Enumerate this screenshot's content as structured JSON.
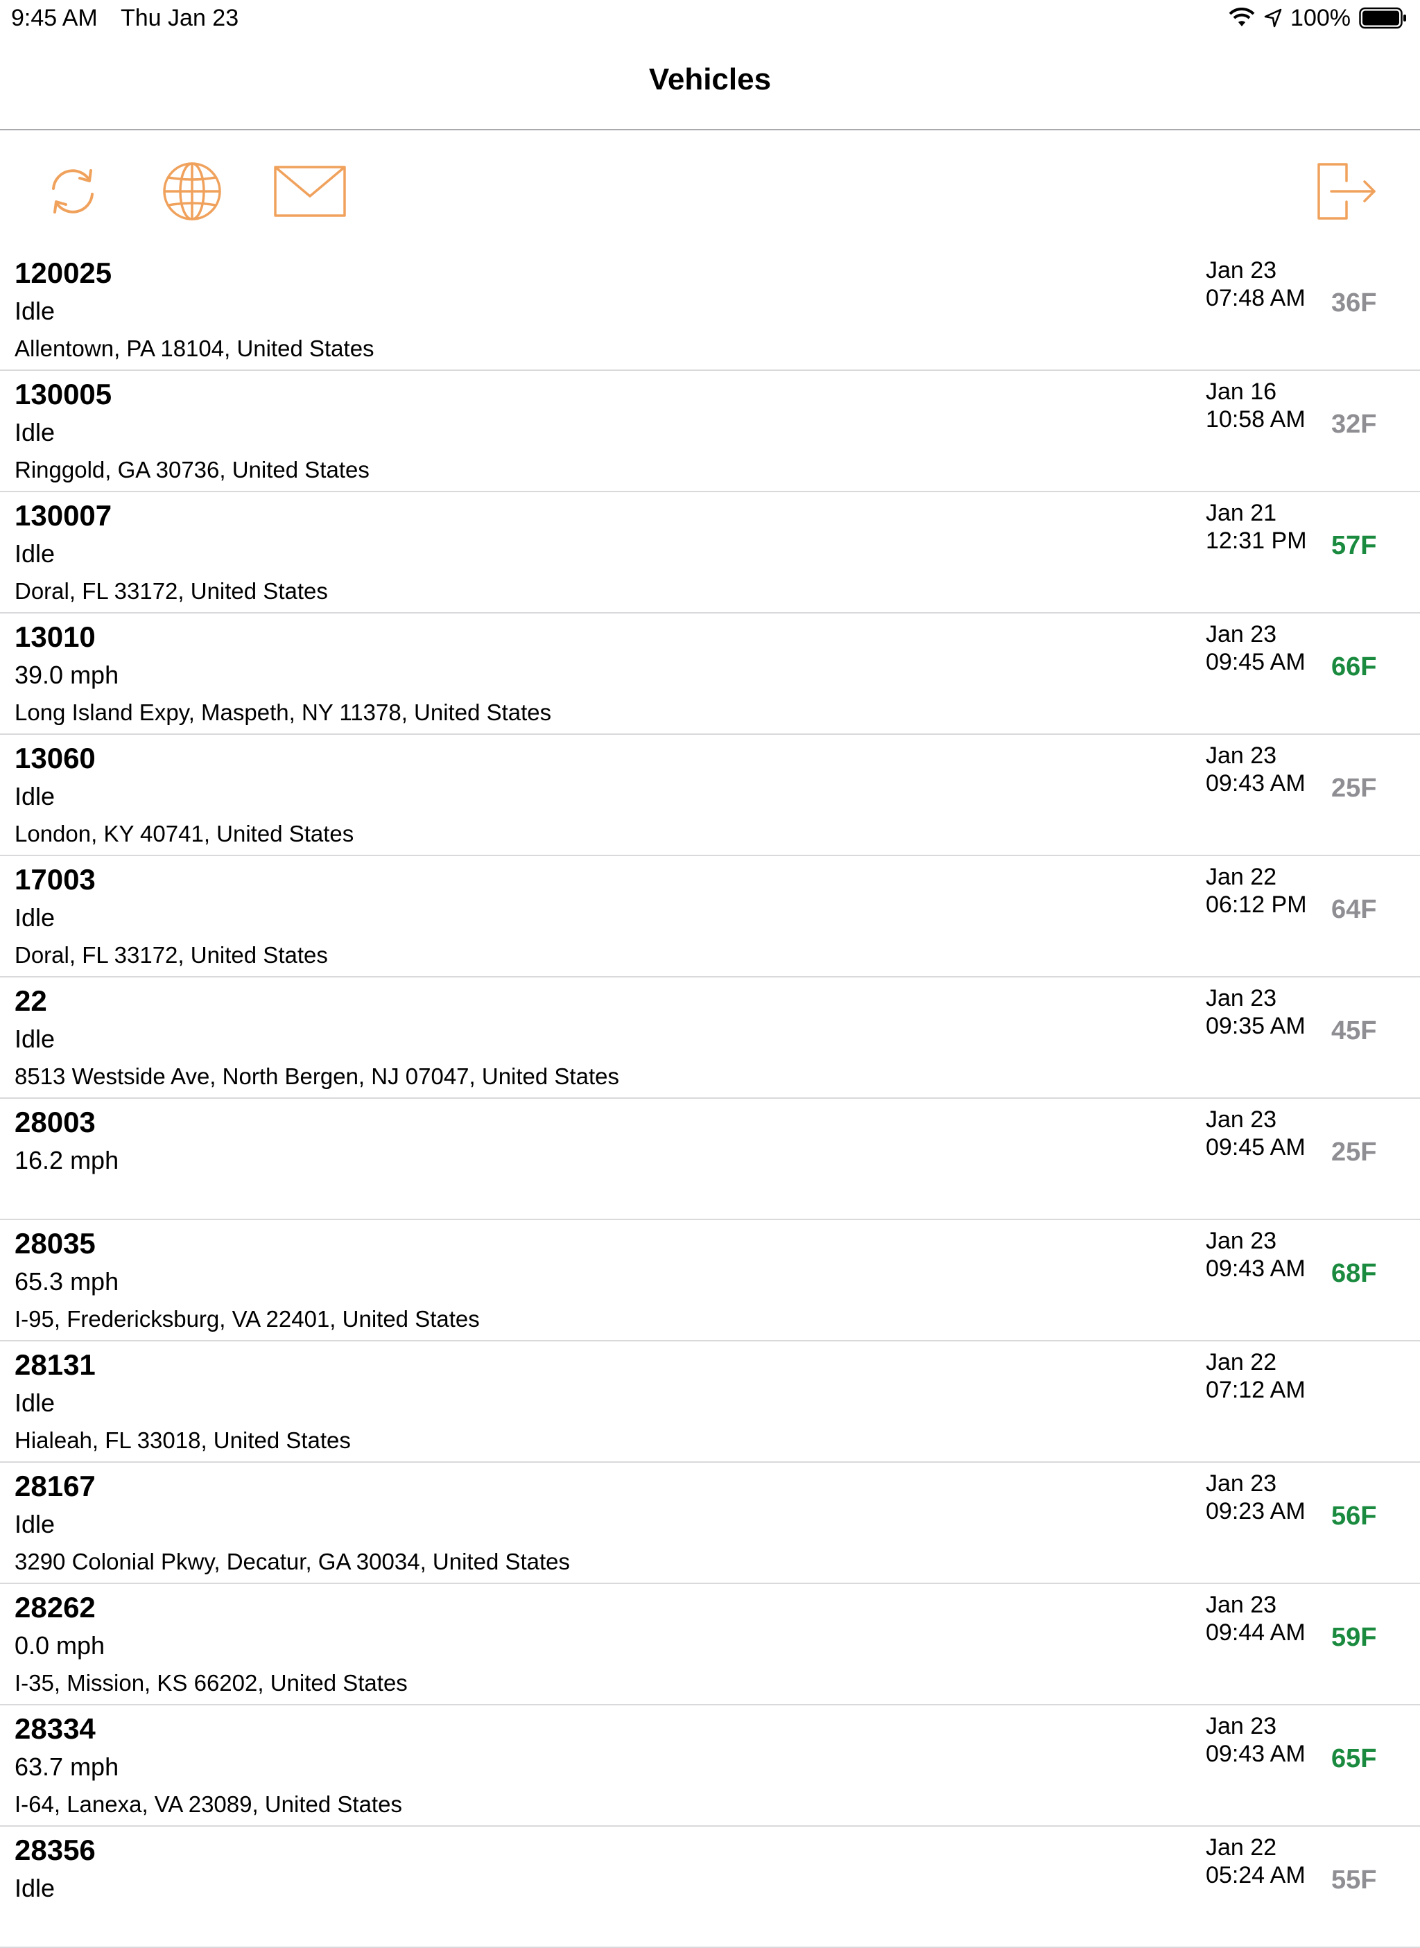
{
  "status_bar": {
    "time": "9:45 AM",
    "date": "Thu Jan 23",
    "battery": "100%"
  },
  "nav": {
    "title": "Vehicles"
  },
  "colors": {
    "accent": "#f0a25d",
    "temp_green": "#1a8a3f",
    "temp_gray": "#8e8e93"
  },
  "vehicles": [
    {
      "id": "120025",
      "status": "Idle",
      "address": "Allentown, PA 18104, United States",
      "date": "Jan 23",
      "time": "07:48 AM",
      "temp": "36F",
      "temp_color": "#8e8e93"
    },
    {
      "id": "130005",
      "status": "Idle",
      "address": "Ringgold, GA 30736, United States",
      "date": "Jan 16",
      "time": "10:58 AM",
      "temp": "32F",
      "temp_color": "#8e8e93"
    },
    {
      "id": "130007",
      "status": "Idle",
      "address": "Doral, FL 33172, United States",
      "date": "Jan 21",
      "time": "12:31 PM",
      "temp": "57F",
      "temp_color": "#1a8a3f"
    },
    {
      "id": "13010",
      "status": "39.0 mph",
      "address": "Long Island Expy, Maspeth, NY 11378, United States",
      "date": "Jan 23",
      "time": "09:45 AM",
      "temp": "66F",
      "temp_color": "#1a8a3f"
    },
    {
      "id": "13060",
      "status": "Idle",
      "address": "London, KY 40741, United States",
      "date": "Jan 23",
      "time": "09:43 AM",
      "temp": "25F",
      "temp_color": "#8e8e93"
    },
    {
      "id": "17003",
      "status": "Idle",
      "address": "Doral, FL 33172, United States",
      "date": "Jan 22",
      "time": "06:12 PM",
      "temp": "64F",
      "temp_color": "#8e8e93"
    },
    {
      "id": "22",
      "status": "Idle",
      "address": "8513 Westside Ave, North Bergen, NJ 07047, United States",
      "date": "Jan 23",
      "time": "09:35 AM",
      "temp": "45F",
      "temp_color": "#8e8e93"
    },
    {
      "id": "28003",
      "status": "16.2 mph",
      "address": "",
      "date": "Jan 23",
      "time": "09:45 AM",
      "temp": "25F",
      "temp_color": "#8e8e93"
    },
    {
      "id": "28035",
      "status": "65.3 mph",
      "address": "I-95, Fredericksburg, VA 22401, United States",
      "date": "Jan 23",
      "time": "09:43 AM",
      "temp": "68F",
      "temp_color": "#1a8a3f"
    },
    {
      "id": "28131",
      "status": "Idle",
      "address": "Hialeah, FL 33018, United States",
      "date": "Jan 22",
      "time": "07:12 AM",
      "temp": "",
      "temp_color": "#8e8e93"
    },
    {
      "id": "28167",
      "status": "Idle",
      "address": "3290 Colonial Pkwy, Decatur, GA 30034, United States",
      "date": "Jan 23",
      "time": "09:23 AM",
      "temp": "56F",
      "temp_color": "#1a8a3f"
    },
    {
      "id": "28262",
      "status": "0.0 mph",
      "address": "I-35, Mission, KS 66202, United States",
      "date": "Jan 23",
      "time": "09:44 AM",
      "temp": "59F",
      "temp_color": "#1a8a3f"
    },
    {
      "id": "28334",
      "status": "63.7 mph",
      "address": "I-64, Lanexa, VA 23089, United States",
      "date": "Jan 23",
      "time": "09:43 AM",
      "temp": "65F",
      "temp_color": "#1a8a3f"
    },
    {
      "id": "28356",
      "status": "Idle",
      "address": "",
      "date": "Jan 22",
      "time": "05:24 AM",
      "temp": "55F",
      "temp_color": "#8e8e93"
    }
  ]
}
